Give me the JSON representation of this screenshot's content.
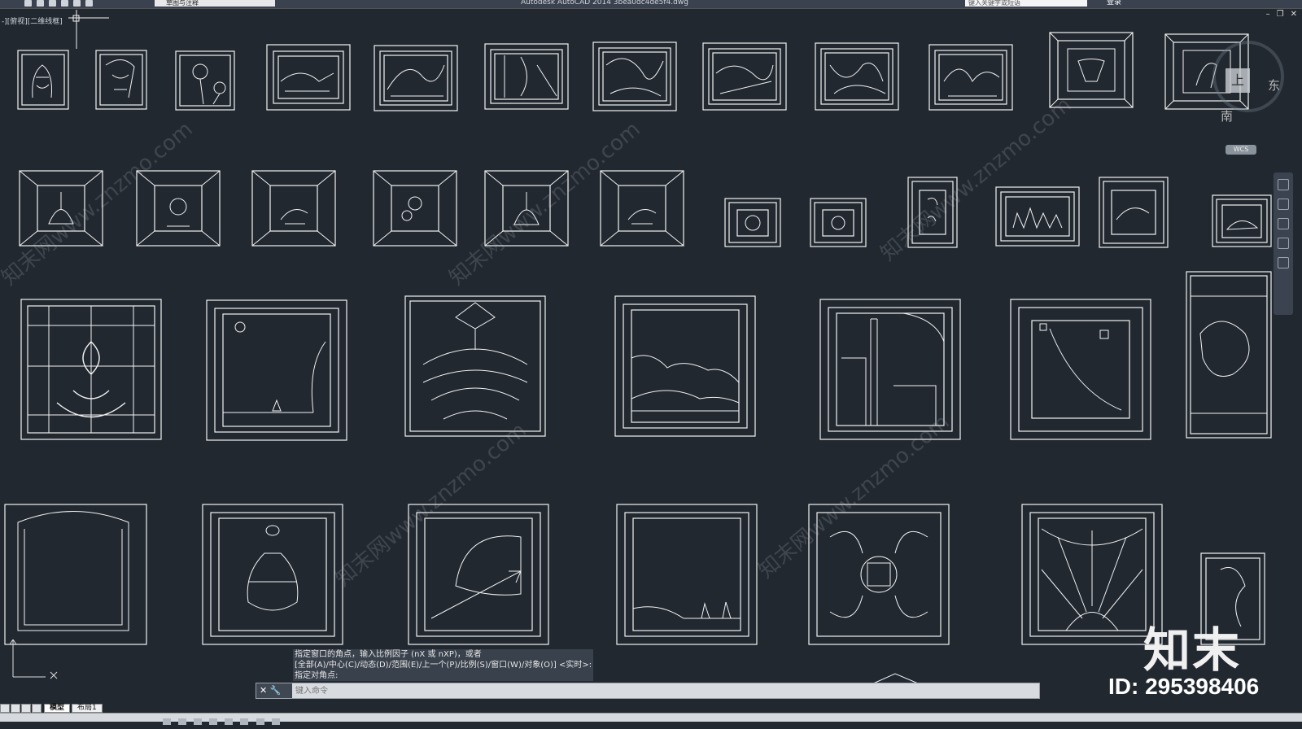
{
  "app": {
    "title": "Autodesk AutoCAD 2014    3bea0dc4de5f4.dwg",
    "workspace": "草图与注释",
    "search_placeholder": "键入关键字或短语",
    "login_label": "登录"
  },
  "viewport": {
    "label": "-][俯视][二维线框]"
  },
  "view_cube": {
    "top_face": "上",
    "south": "南",
    "east": "东",
    "wcs": "WCS"
  },
  "command": {
    "history": [
      "指定窗口的角点，输入比例因子 (nX 或 nXP)，或者",
      "[全部(A)/中心(C)/动态(D)/范围(E)/上一个(P)/比例(S)/窗口(W)/对象(O)] <实时>:",
      "指定对角点:"
    ],
    "prompt_symbol": "✕ 🔧",
    "placeholder": "键入命令"
  },
  "layout_tabs": [
    "模型",
    "布局1"
  ],
  "watermarks": [
    "知末网www.znzmo.com"
  ],
  "brand": {
    "logo_text": "知末",
    "id_text": "ID: 295398406"
  },
  "colors": {
    "canvas": "#212830",
    "lines": "#ffffff"
  }
}
